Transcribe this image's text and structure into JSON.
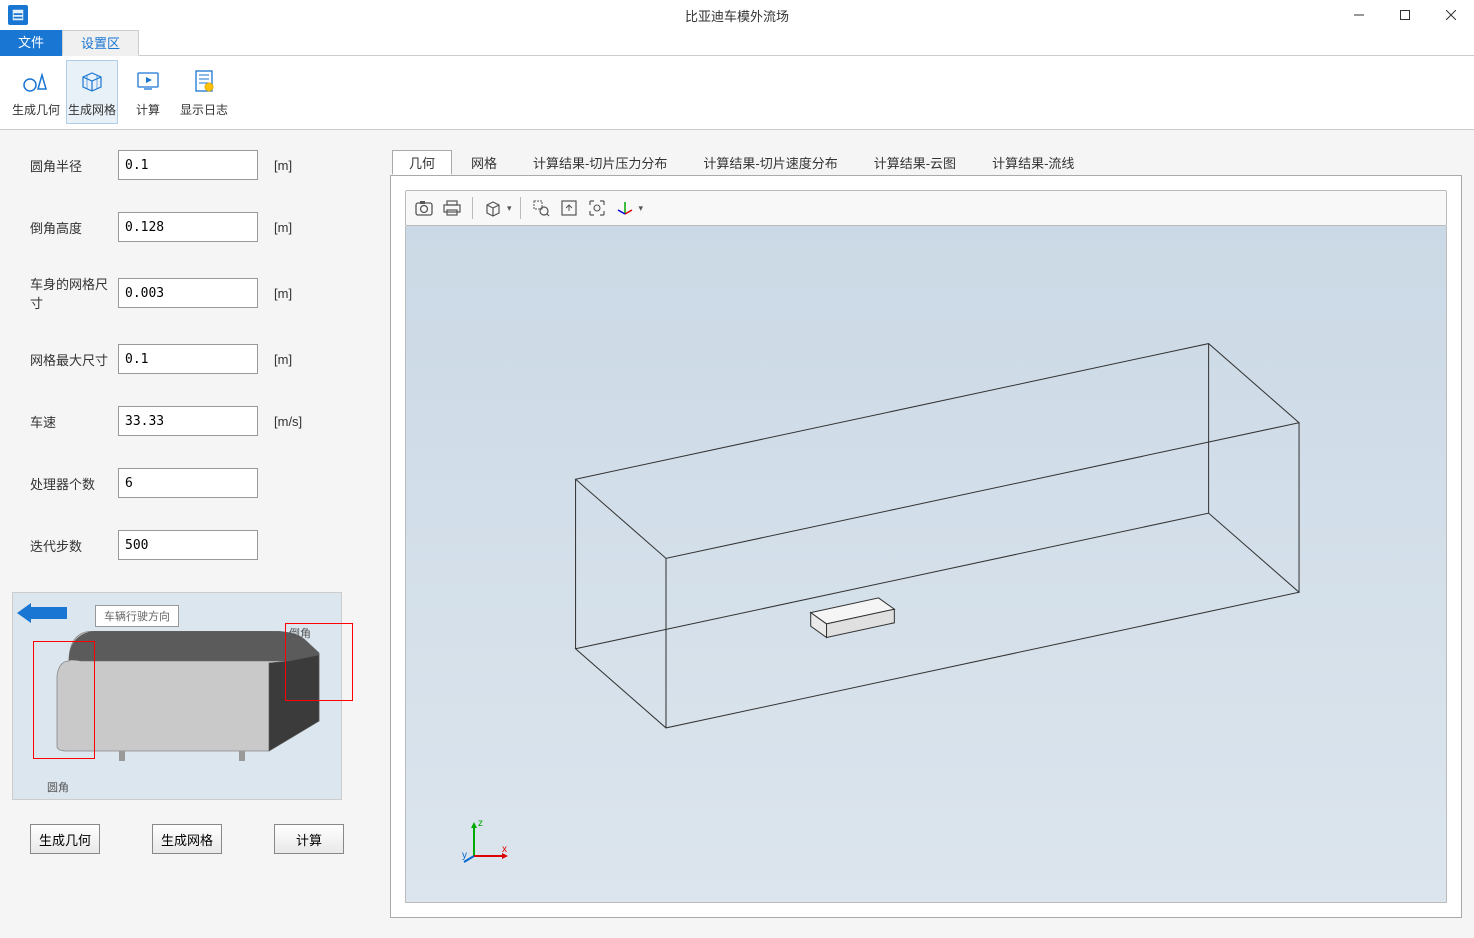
{
  "window": {
    "title": "比亚迪车模外流场"
  },
  "menu": {
    "file": "文件",
    "settings": "设置区"
  },
  "ribbon": {
    "gen_geometry": "生成几何",
    "gen_mesh": "生成网格",
    "compute": "计算",
    "show_log": "显示日志"
  },
  "params": {
    "fillet_radius": {
      "label": "圆角半径",
      "value": "0.1",
      "unit": "[m]"
    },
    "chamfer_height": {
      "label": "倒角高度",
      "value": "0.128",
      "unit": "[m]"
    },
    "body_mesh_size": {
      "label": "车身的网格尺寸",
      "value": "0.003",
      "unit": "[m]"
    },
    "max_mesh_size": {
      "label": "网格最大尺寸",
      "value": "0.1",
      "unit": "[m]"
    },
    "speed": {
      "label": "车速",
      "value": "33.33",
      "unit": "[m/s]"
    },
    "cpu_count": {
      "label": "处理器个数",
      "value": "6",
      "unit": ""
    },
    "iterations": {
      "label": "迭代步数",
      "value": "500",
      "unit": ""
    }
  },
  "diagram": {
    "direction_label": "车辆行驶方向",
    "fillet_caption": "圆角",
    "chamfer_caption": "倒角"
  },
  "actions": {
    "gen_geometry": "生成几何",
    "gen_mesh": "生成网格",
    "compute": "计算"
  },
  "viewer_tabs": {
    "geometry": "几何",
    "mesh": "网格",
    "slice_pressure": "计算结果-切片压力分布",
    "slice_velocity": "计算结果-切片速度分布",
    "contour": "计算结果-云图",
    "streamline": "计算结果-流线"
  },
  "axis": {
    "x": "x",
    "y": "y",
    "z": "z"
  }
}
